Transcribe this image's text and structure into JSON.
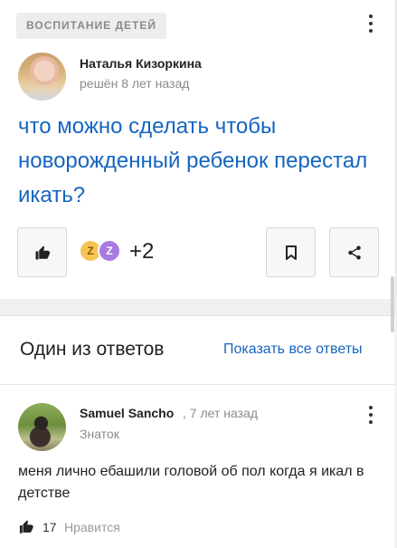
{
  "question_card": {
    "category": "ВОСПИТАНИЕ ДЕТЕЙ",
    "author_name": "Наталья Кизоркина",
    "solved_meta": "решён 8 лет назад",
    "question_text": "что можно сделать чтобы новорожденный ребенок перестал икать?",
    "reaction_badges": [
      "Z",
      "Z"
    ],
    "extra_count": "+2",
    "icons": {
      "like": "thumbs-up-icon",
      "bookmark": "bookmark-icon",
      "share": "share-icon",
      "menu": "more-vertical-icon"
    }
  },
  "answers": {
    "title": "Один из ответов",
    "show_all_label": "Показать все ответы",
    "answer": {
      "author_name": "Samuel Sancho",
      "time": ", 7 лет назад",
      "rank": "Знаток",
      "text": "меня лично ебашили головой об пол когда я икал в детстве",
      "likes": "17",
      "likes_label": "Нравится"
    }
  },
  "colors": {
    "link": "#1565c0",
    "badge1": "#f6c453",
    "badge2": "#a77be0"
  }
}
